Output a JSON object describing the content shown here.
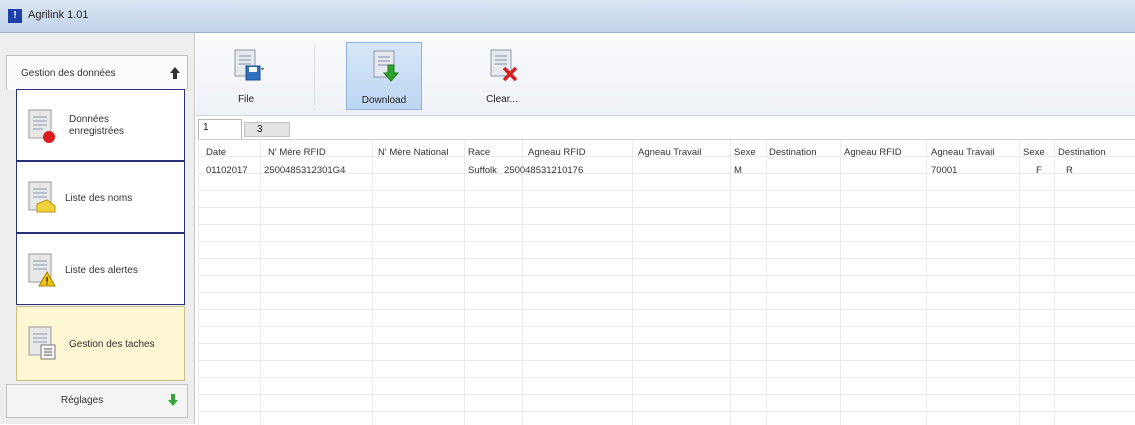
{
  "window": {
    "title": "Agrilink 1.01"
  },
  "sidebar": {
    "header_label": "Gestion des données",
    "items": [
      {
        "label": "Données enregistrées",
        "icon": "document-red-dot-icon"
      },
      {
        "label": "Liste des noms",
        "icon": "document-yellow-tag-icon"
      },
      {
        "label": "Liste des alertes",
        "icon": "document-warning-icon"
      },
      {
        "label": "Gestion des taches",
        "icon": "document-list-icon"
      }
    ],
    "footer_label": "Réglages"
  },
  "toolbar": {
    "file_label": "File",
    "download_label": "Download",
    "clear_label": "Clear..."
  },
  "tabs": [
    "1",
    "3"
  ],
  "table": {
    "columns": [
      "Date",
      "N' Mère RFID",
      "N' Mère National",
      "Race",
      "Agneau RFID",
      "Agneau Travail",
      "Sexe",
      "Destination",
      "Agneau RFID",
      "Agneau Travail",
      "Sexe",
      "Destination"
    ],
    "rows": [
      [
        "01102017",
        "2500485312301G4",
        "",
        "Suffolk",
        "250048531210176",
        "",
        "M",
        "",
        "",
        "70001",
        "F",
        "R"
      ]
    ]
  },
  "colors": {
    "accent": "#1e3fa8",
    "active_item_bg": "#fcf6d2",
    "sidebar_border": "#2a2f7a"
  }
}
